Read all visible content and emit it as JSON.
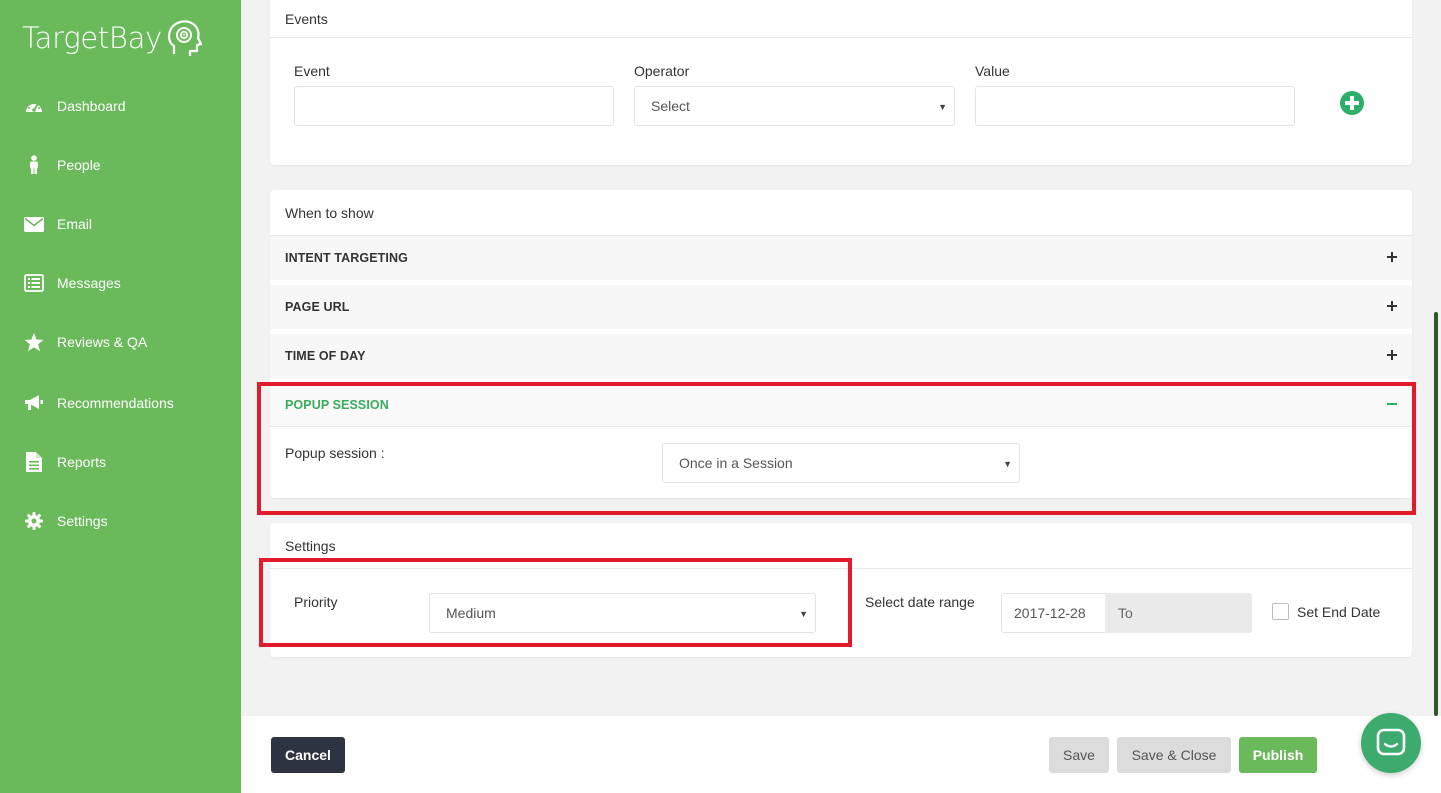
{
  "brand": {
    "name": "TargetBay"
  },
  "sidebar": {
    "items": [
      {
        "label": "Dashboard",
        "icon": "dashboard-icon"
      },
      {
        "label": "People",
        "icon": "person-icon"
      },
      {
        "label": "Email",
        "icon": "envelope-icon"
      },
      {
        "label": "Messages",
        "icon": "messages-icon"
      },
      {
        "label": "Reviews & QA",
        "icon": "star-icon"
      },
      {
        "label": "Recommendations",
        "icon": "megaphone-icon"
      },
      {
        "label": "Reports",
        "icon": "document-icon"
      },
      {
        "label": "Settings",
        "icon": "gear-icon"
      }
    ]
  },
  "events": {
    "title": "Events",
    "event_label": "Event",
    "operator_label": "Operator",
    "operator_value": "Select",
    "value_label": "Value"
  },
  "when_to_show": {
    "title": "When to show",
    "sections": [
      {
        "label": "INTENT TARGETING",
        "expanded": false
      },
      {
        "label": "PAGE URL",
        "expanded": false
      },
      {
        "label": "TIME OF DAY",
        "expanded": false
      },
      {
        "label": "POPUP SESSION",
        "expanded": true
      }
    ],
    "popup_session_label": "Popup session :",
    "popup_session_value": "Once in a Session"
  },
  "settings": {
    "title": "Settings",
    "priority_label": "Priority",
    "priority_value": "Medium",
    "date_range_label": "Select date range",
    "start_date": "2017-12-28",
    "end_placeholder": "To",
    "set_end_date_label": "Set End Date"
  },
  "footer": {
    "cancel_label": "Cancel",
    "save_label": "Save",
    "save_close_label": "Save & Close",
    "publish_label": "Publish"
  },
  "colors": {
    "sidebar": "#6aba5b",
    "accent_green": "#2bb06a",
    "highlight_red": "#e21b2a",
    "cancel_dark": "#2d3340"
  }
}
